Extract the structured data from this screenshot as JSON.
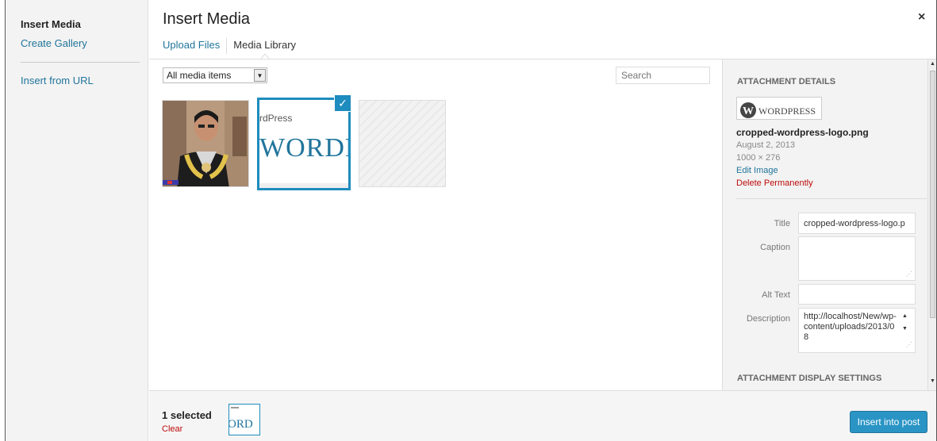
{
  "menu": {
    "items": [
      {
        "label": "Insert Media"
      },
      {
        "label": "Create Gallery"
      },
      {
        "label": "Insert from URL"
      }
    ]
  },
  "modal": {
    "title": "Insert Media",
    "close_icon": "×"
  },
  "tabs": [
    {
      "label": "Upload Files"
    },
    {
      "label": "Media Library"
    }
  ],
  "toolbar": {
    "filter_selected": "All media items",
    "search_placeholder": "Search"
  },
  "attachments": [
    {
      "name": "photo-person-thumbnail",
      "selected": false
    },
    {
      "name": "cropped-wordpress-logo",
      "selected": true,
      "text_small": "rdPress",
      "text_big": "WORDP"
    },
    {
      "name": "placeholder-thumbnail",
      "selected": false
    }
  ],
  "details": {
    "heading": "Attachment Details",
    "thumb_text": "WORDPRESS",
    "filename": "cropped-wordpress-logo.png",
    "date": "August 2, 2013",
    "dimensions": "1000 × 276",
    "edit_label": "Edit Image",
    "delete_label": "Delete Permanently",
    "fields": {
      "title_label": "Title",
      "title_value": "cropped-wordpress-logo.p",
      "caption_label": "Caption",
      "caption_value": "",
      "alt_label": "Alt Text",
      "alt_value": "",
      "description_label": "Description",
      "description_value": "http://localhost/New/wp-content/uploads/2013/08"
    },
    "display_heading": "Attachment Display Settings"
  },
  "footer": {
    "selected_count": "1 selected",
    "clear_label": "Clear",
    "selected_thumb_text": "ORD",
    "insert_label": "Insert into post"
  },
  "colors": {
    "accent": "#1e8cbe",
    "link": "#21759b",
    "danger": "#bc0b0b",
    "button": "#2a95c5"
  }
}
